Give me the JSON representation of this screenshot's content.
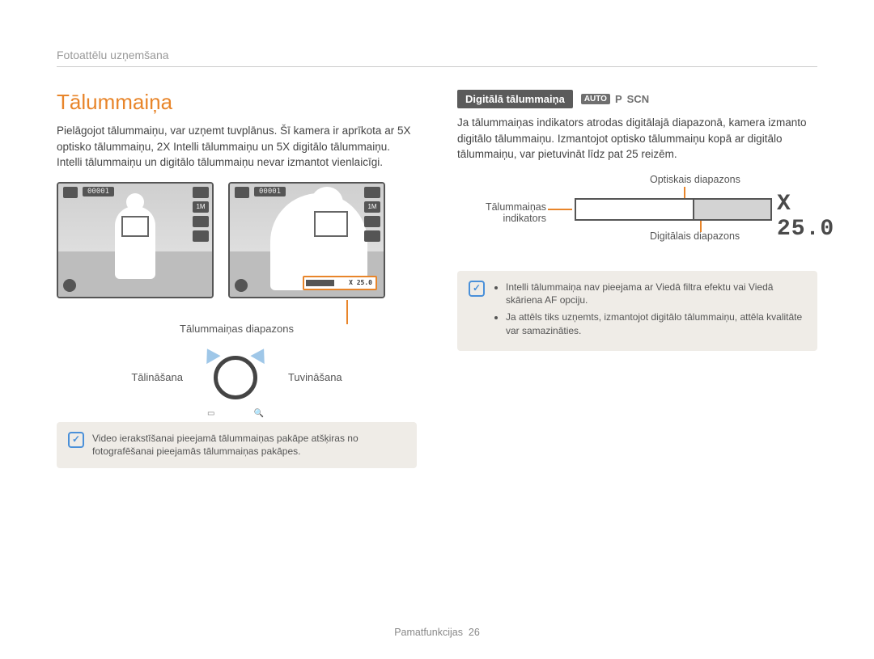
{
  "header": {
    "breadcrumb": "Fotoattēlu uzņemšana"
  },
  "title": "Tālummaiņa",
  "left": {
    "intro": "Pielāgojot tālummaiņu, var uzņemt tuvplānus. Šī kamera ir aprīkota ar 5X optisko tālummaiņu, 2X Intelli tālummaiņu un 5X digitālo tālummaiņu. Intelli tālummaiņu un digitālo tālummaiņu nevar izmantot vienlaicīgi.",
    "preview_counter": "00001",
    "preview_zoom_value": "X 25.0",
    "caption_range": "Tālummaiņas diapazons",
    "zoom_out": "Tālināšana",
    "zoom_in": "Tuvināšana",
    "ring_left_icon": "▭",
    "ring_right_icon": "🔍",
    "note": "Video ierakstīšanai pieejamā tālummaiņas pakāpe atšķiras no fotografēšanai pieejamās tālummaiņas pakāpes."
  },
  "right": {
    "subheading": "Digitālā tālummaiņa",
    "modes": {
      "auto": "AUTO",
      "p": "P",
      "scn": "SCN"
    },
    "body": "Ja tālummaiņas indikators atrodas digitālajā diapazonā, kamera izmanto digitālo tālummaiņu. Izmantojot optisko tālummaiņu kopā ar digitālo tālummaiņu, var pietuvināt līdz pat 25 reizēm.",
    "diagram": {
      "optical": "Optiskais diapazons",
      "indicator": "Tālummaiņas indikators",
      "digital": "Digitālais diapazons",
      "value": "X 25.0"
    },
    "notes": [
      "Intelli tālummaiņa nav pieejama ar Viedā filtra efektu vai Viedā skāriena AF opciju.",
      "Ja attēls tiks uzņemts, izmantojot digitālo tālummaiņu, attēla kvalitāte var samazināties."
    ]
  },
  "footer": {
    "section": "Pamatfunkcijas",
    "page": "26"
  },
  "note_glyph": "✓"
}
